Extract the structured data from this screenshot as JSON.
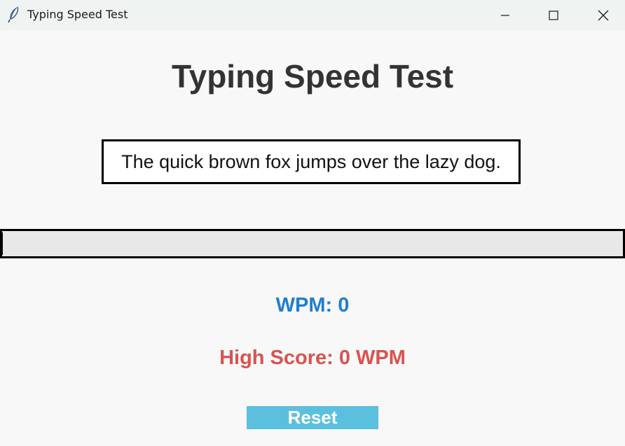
{
  "window": {
    "title": "Typing Speed Test",
    "icon": "feather-icon",
    "controls": [
      "minimize-icon",
      "maximize-icon",
      "close-icon"
    ]
  },
  "main": {
    "heading": "Typing Speed Test",
    "sentence": "The quick brown fox jumps over the lazy dog.",
    "input": {
      "value": "",
      "placeholder": ""
    },
    "wpm_text": "WPM: 0",
    "high_score_text": "High Score: 0 WPM",
    "reset_label": "Reset"
  },
  "colors": {
    "background": "#f8f8f8",
    "titlebar": "#eff4f2",
    "heading": "#333333",
    "wpm": "#1f7fcf",
    "high_score": "#d9534f",
    "reset_button": "#5bc0de",
    "input_background": "#e8e8e8"
  }
}
